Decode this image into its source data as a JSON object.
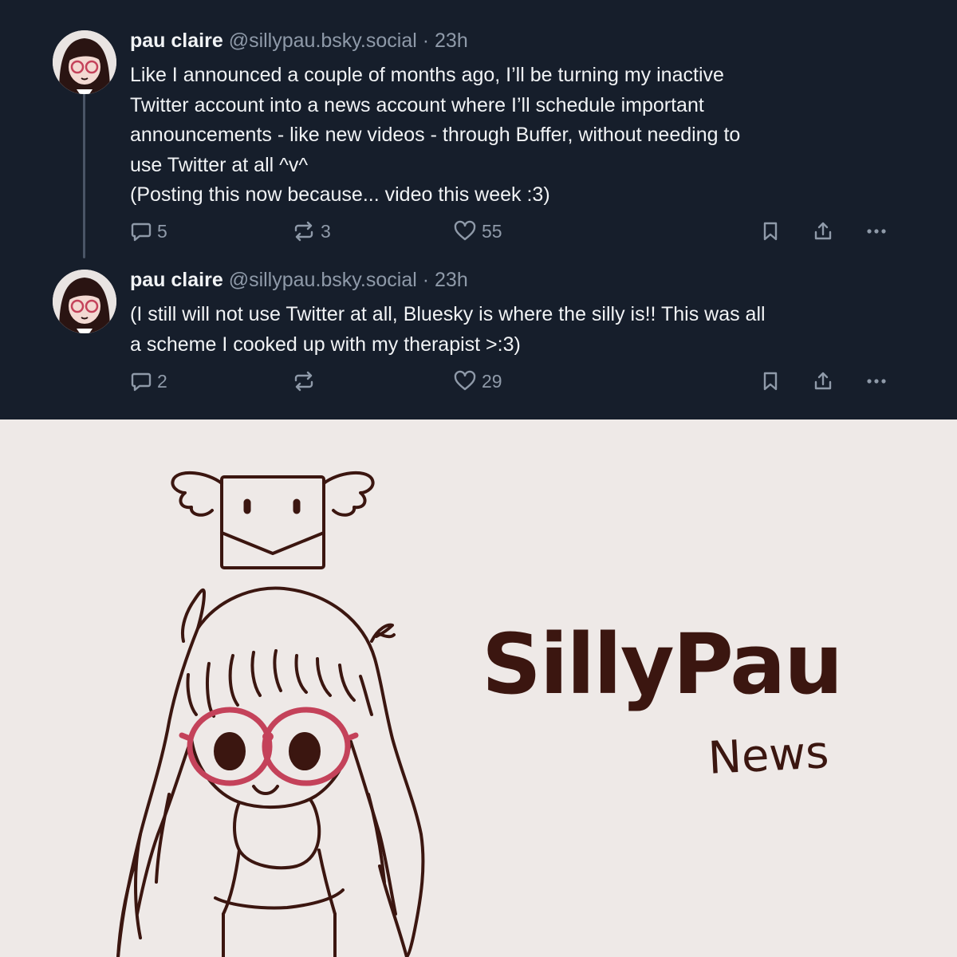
{
  "posts": [
    {
      "author": {
        "name": "pau claire",
        "handle": "@sillypau.bsky.social"
      },
      "separator": "·",
      "time": "23h",
      "lines": [
        "Like I announced a couple of months ago, I’ll be turning my inactive",
        "Twitter account into a news account where I’ll schedule important",
        "announcements - like new videos - through Buffer, without needing to",
        "use Twitter at all ^v^",
        "(Posting this now because... video this week :3)"
      ],
      "counts": {
        "replies": "5",
        "reposts": "3",
        "likes": "55"
      }
    },
    {
      "author": {
        "name": "pau claire",
        "handle": "@sillypau.bsky.social"
      },
      "separator": "·",
      "time": "23h",
      "lines": [
        "(I still will not use Twitter at all, Bluesky is where the silly is!! This was all",
        "a scheme I cooked up with my therapist >:3)"
      ],
      "counts": {
        "replies": "2",
        "reposts": "",
        "likes": "29"
      }
    }
  ],
  "icons": {
    "reply": "speech-bubble-icon",
    "repost": "repost-arrows-icon",
    "like": "heart-outline-icon",
    "save": "bookmark-icon",
    "share": "share-upload-icon",
    "more": "ellipsis-icon"
  },
  "artwork": {
    "logo_title": "SillyPau",
    "logo_subtitle": "News"
  },
  "colors": {
    "feed_background": "#161e2b",
    "text_primary": "#f1f3f5",
    "text_secondary": "#8f9aa9",
    "art_background": "#eee9e7",
    "ink": "#3b1610",
    "glasses": "#c4425a"
  }
}
